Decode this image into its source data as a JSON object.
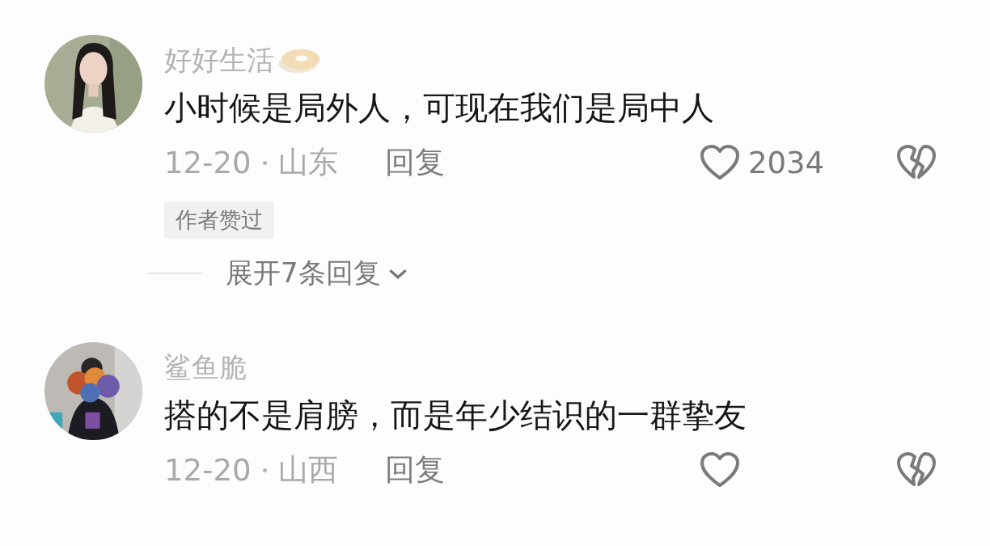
{
  "comments": [
    {
      "user": {
        "name": "好好生活",
        "badge": true
      },
      "text": "小时候是局外人，可现在我们是局中人",
      "date": "12-20",
      "location": "山东",
      "reply_label": "回复",
      "likes": "2034",
      "tag": "作者赞过",
      "expand": {
        "label": "展开7条回复"
      }
    },
    {
      "user": {
        "name": "鲨鱼脆"
      },
      "text": "搭的不是肩膀，而是年少结识的一群挚友",
      "date": "12-20",
      "location": "山西",
      "reply_label": "回复"
    }
  ]
}
